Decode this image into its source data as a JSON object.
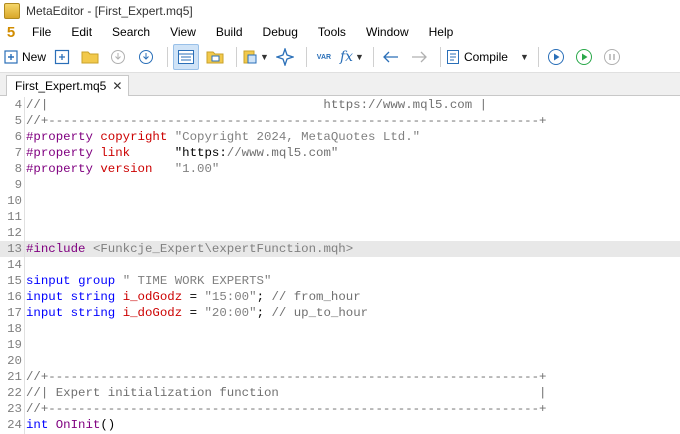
{
  "window": {
    "title": "MetaEditor - [First_Expert.mq5]"
  },
  "menubar": {
    "logo": "5",
    "items": [
      "File",
      "Edit",
      "Search",
      "View",
      "Build",
      "Debug",
      "Tools",
      "Window",
      "Help"
    ]
  },
  "toolbar": {
    "new_label": "New",
    "compile_label": "Compile",
    "var_icon_text": "VAR",
    "fx_icon_text": "f𝑥"
  },
  "tab": {
    "label": "First_Expert.mq5",
    "close": "✕"
  },
  "editor": {
    "lines": [
      {
        "n": "4",
        "text": "//|                                     https://www.mql5.com |"
      },
      {
        "n": "5",
        "text": "//+------------------------------------------------------------------+"
      },
      {
        "n": "6",
        "text": "#property copyright \"Copyright 2024, MetaQuotes Ltd.\""
      },
      {
        "n": "7",
        "text": "#property link      \"https://www.mql5.com\""
      },
      {
        "n": "8",
        "text": "#property version   \"1.00\""
      },
      {
        "n": "9",
        "text": ""
      },
      {
        "n": "10",
        "text": ""
      },
      {
        "n": "11",
        "text": ""
      },
      {
        "n": "12",
        "text": ""
      },
      {
        "n": "13",
        "text": "#include <Funkcje_Expert\\expertFunction.mqh>"
      },
      {
        "n": "14",
        "text": ""
      },
      {
        "n": "15",
        "text": "sinput group \" TIME WORK EXPERTS\""
      },
      {
        "n": "16",
        "text": "input string i_odGodz = \"15:00\"; // from_hour"
      },
      {
        "n": "17",
        "text": "input string i_doGodz = \"20:00\"; // up_to_hour"
      },
      {
        "n": "18",
        "text": ""
      },
      {
        "n": "19",
        "text": ""
      },
      {
        "n": "20",
        "text": ""
      },
      {
        "n": "21",
        "text": "//+------------------------------------------------------------------+"
      },
      {
        "n": "22",
        "text": "//| Expert initialization function                                   |"
      },
      {
        "n": "23",
        "text": "//+------------------------------------------------------------------+"
      },
      {
        "n": "24",
        "text": "int OnInit()"
      }
    ],
    "highlighted_line": "13"
  }
}
